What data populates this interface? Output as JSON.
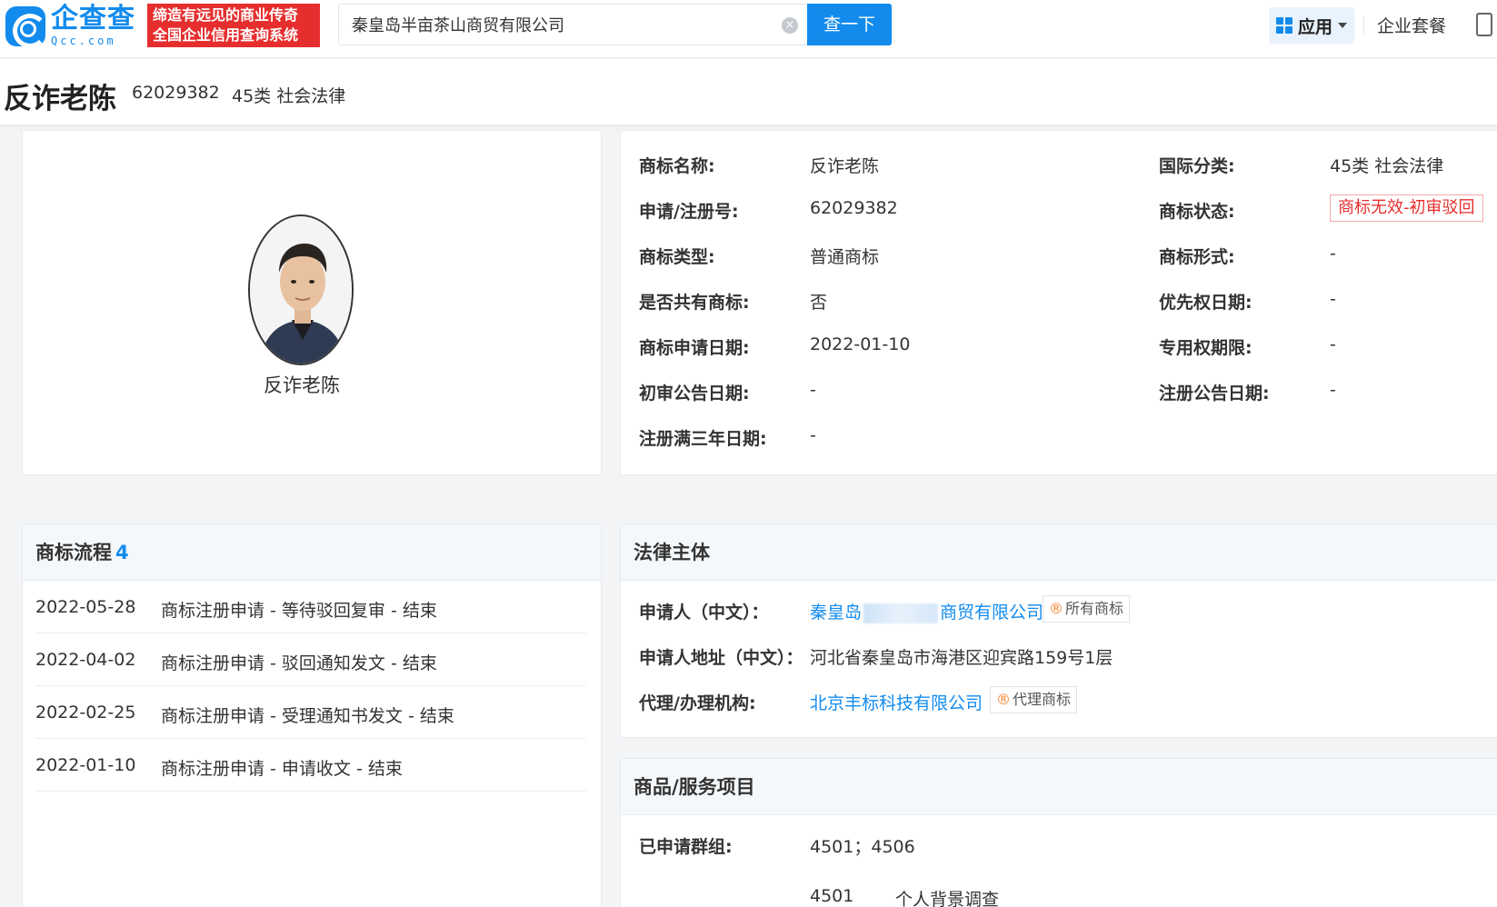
{
  "header": {
    "logo_cn": "企查查",
    "logo_en": "Qcc.com",
    "slogan_line1": "缔造有远见的商业传奇",
    "slogan_line2": "全国企业信用查询系统",
    "search_value": "秦皇岛半亩茶山商贸有限公司",
    "search_button": "查一下",
    "apps_label": "应用",
    "package_label": "企业套餐"
  },
  "title": {
    "name": "反诈老陈",
    "reg_no": "62029382",
    "class": "45类 社会法律"
  },
  "image": {
    "caption": "反诈老陈"
  },
  "info": {
    "rows": [
      {
        "label": "商标名称:",
        "value": "反诈老陈"
      },
      {
        "label": "申请/注册号:",
        "value": "62029382"
      },
      {
        "label": "商标类型:",
        "value": "普通商标"
      },
      {
        "label": "是否共有商标:",
        "value": "否"
      },
      {
        "label": "商标申请日期:",
        "value": "2022-01-10"
      },
      {
        "label": "初审公告日期:",
        "value": "-"
      },
      {
        "label": "注册满三年日期:",
        "value": "-"
      }
    ],
    "rows_right": [
      {
        "label": "国际分类:",
        "value": "45类 社会法律"
      },
      {
        "label": "商标状态:",
        "value": "商标无效-初审驳回"
      },
      {
        "label": "商标形式:",
        "value": "-"
      },
      {
        "label": "优先权日期:",
        "value": "-"
      },
      {
        "label": "专用权期限:",
        "value": "-"
      },
      {
        "label": "注册公告日期:",
        "value": "-"
      }
    ]
  },
  "flow": {
    "title": "商标流程",
    "count": "4",
    "items": [
      {
        "date": "2022-05-28",
        "desc": "商标注册申请 - 等待驳回复审 - 结束"
      },
      {
        "date": "2022-04-02",
        "desc": "商标注册申请 - 驳回通知发文 - 结束"
      },
      {
        "date": "2022-02-25",
        "desc": "商标注册申请 - 受理通知书发文 - 结束"
      },
      {
        "date": "2022-01-10",
        "desc": "商标注册申请 - 申请收文 - 结束"
      }
    ]
  },
  "legal": {
    "title": "法律主体",
    "applicant_label": "申请人（中文）：",
    "applicant_prefix": "秦皇岛",
    "applicant_suffix": "商贸有限公司",
    "applicant_badge": "所有商标",
    "address_label": "申请人地址（中文）：",
    "address_value": "河北省秦皇岛市海港区迎宾路159号1层",
    "agent_label": "代理/办理机构:",
    "agent_value": "北京丰标科技有限公司",
    "agent_badge": "代理商标"
  },
  "goods": {
    "title": "商品/服务项目",
    "group_label": "已申请群组:",
    "group_value": "4501；4506",
    "item_code": "4501",
    "item_name": "个人背景调查"
  },
  "colors": {
    "brand": "#128bed",
    "danger": "#e62e2e"
  }
}
